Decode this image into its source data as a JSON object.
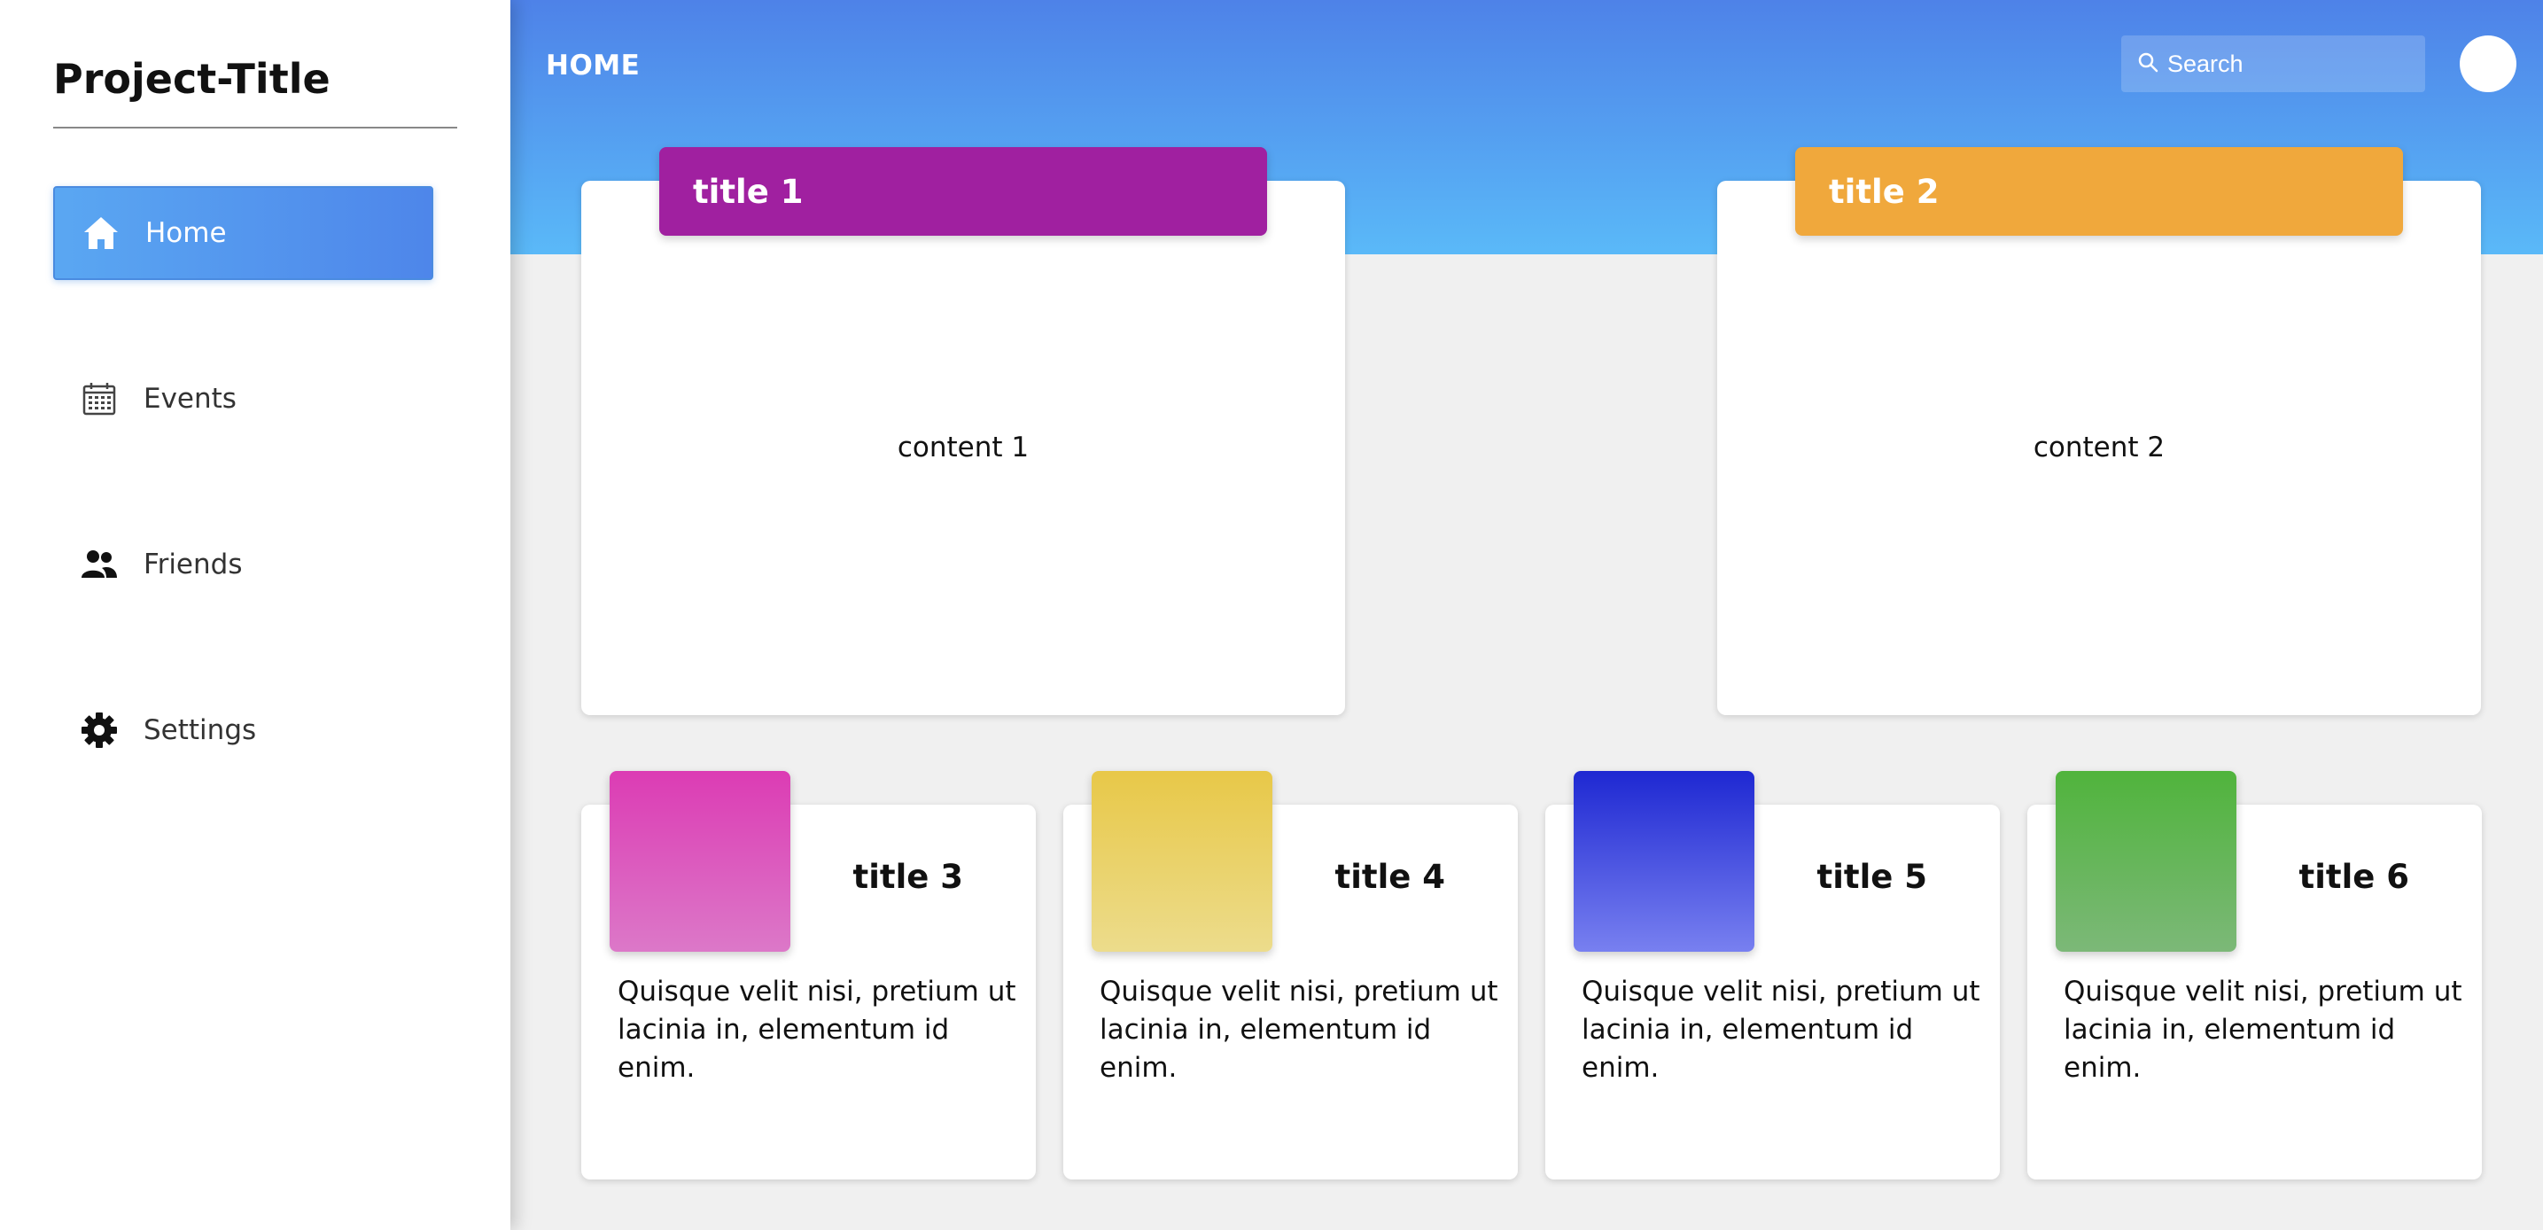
{
  "sidebar": {
    "project_title": "Project-Title",
    "items": [
      {
        "label": "Home",
        "icon": "home-icon",
        "active": true
      },
      {
        "label": "Events",
        "icon": "calendar-icon",
        "active": false
      },
      {
        "label": "Friends",
        "icon": "friends-icon",
        "active": false
      },
      {
        "label": "Settings",
        "icon": "gear-icon",
        "active": false
      }
    ]
  },
  "header": {
    "title": "HOME",
    "search_placeholder": "Search"
  },
  "big_cards": [
    {
      "title": "title 1",
      "content": "content 1",
      "color": "#a020a0"
    },
    {
      "title": "title 2",
      "content": "content 2",
      "color": "#f0a83c"
    }
  ],
  "small_cards": [
    {
      "title": "title 3",
      "text": "Quisque velit nisi, pretium ut lacinia in, elementum id enim.",
      "gradient": [
        "#dc3cb4",
        "#dc78c8"
      ]
    },
    {
      "title": "title 4",
      "text": "Quisque velit nisi, pretium ut lacinia in, elementum id enim.",
      "gradient": [
        "#e8c848",
        "#ecdc8c"
      ]
    },
    {
      "title": "title 5",
      "text": "Quisque velit nisi, pretium ut lacinia in, elementum id enim.",
      "gradient": [
        "#1e28d2",
        "#7880f0"
      ]
    },
    {
      "title": "title 6",
      "text": "Quisque velit nisi, pretium ut lacinia in, elementum id enim.",
      "gradient": [
        "#50b43c",
        "#7cb878"
      ]
    }
  ],
  "colors": {
    "header_gradient": [
      "#4e82e8",
      "#5ab9f8"
    ],
    "active_nav": "#4e86ea",
    "background": "#f0f0f0"
  }
}
